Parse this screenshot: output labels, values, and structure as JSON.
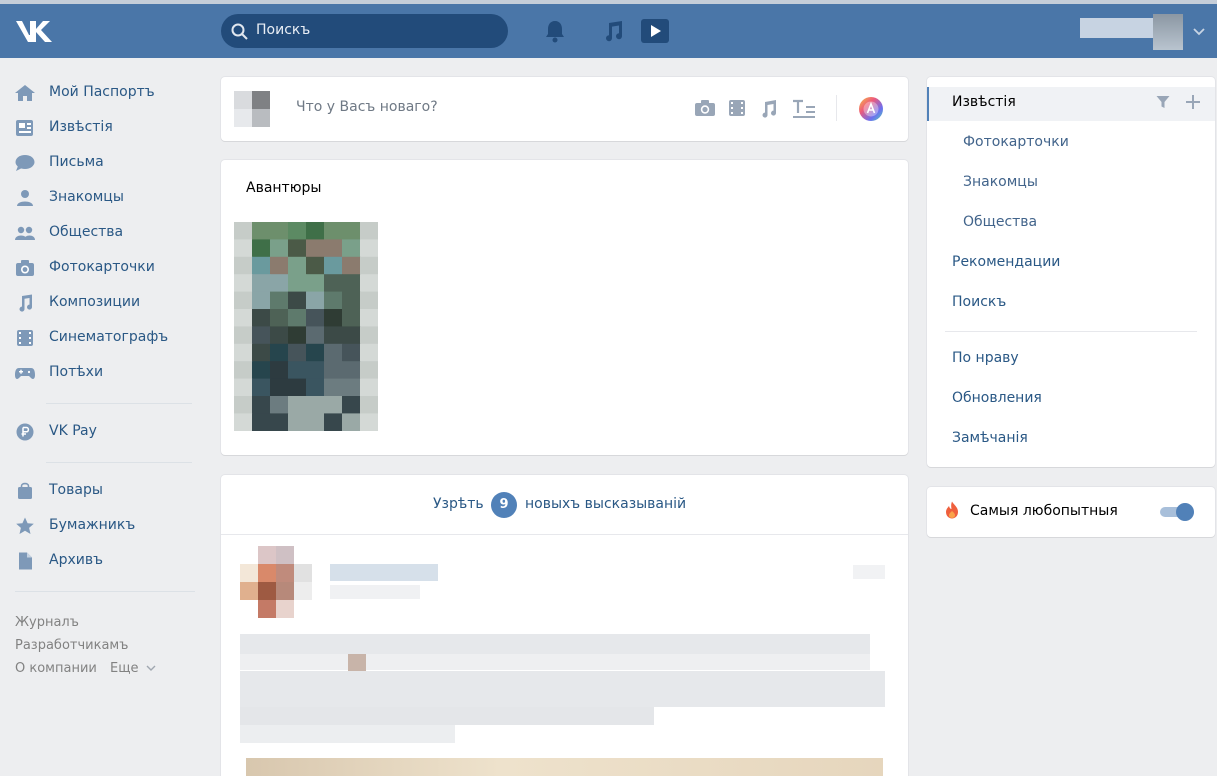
{
  "header": {
    "logo_text": "VK",
    "search_placeholder": "Поискъ"
  },
  "nav": {
    "items": [
      {
        "label": "Мой Паспортъ",
        "icon": "home-icon"
      },
      {
        "label": "Извѣстія",
        "icon": "news-icon"
      },
      {
        "label": "Письма",
        "icon": "messages-icon"
      },
      {
        "label": "Знакомцы",
        "icon": "friend-icon"
      },
      {
        "label": "Общества",
        "icon": "groups-icon"
      },
      {
        "label": "Фотокарточки",
        "icon": "camera-icon"
      },
      {
        "label": "Композиции",
        "icon": "music-icon"
      },
      {
        "label": "Синематографъ",
        "icon": "film-icon"
      },
      {
        "label": "Потѣхи",
        "icon": "gamepad-icon"
      }
    ],
    "pay": {
      "label": "VK Pay",
      "icon": "vkpay-icon"
    },
    "extra": [
      {
        "label": "Товары",
        "icon": "bag-icon"
      },
      {
        "label": "Бумажникъ",
        "icon": "star-icon"
      },
      {
        "label": "Архивъ",
        "icon": "document-icon"
      }
    ],
    "footer": {
      "journal": "Журналъ",
      "developers": "Разработчикамъ",
      "about": "О компании",
      "more": "Еще"
    }
  },
  "composer": {
    "placeholder": "Что у Васъ новаго?"
  },
  "stories": {
    "title": "Авантюры"
  },
  "feed": {
    "new_posts_prefix": "Узрѣть",
    "new_posts_count": "9",
    "new_posts_suffix": "новыхъ высказываній"
  },
  "right_menu": {
    "active": "Извѣстія",
    "subitems": [
      "Фотокарточки",
      "Знакомцы",
      "Общества"
    ],
    "items": [
      "Рекомендации",
      "Поискъ"
    ],
    "items2": [
      "По нраву",
      "Обновления",
      "Замѣчанія"
    ]
  },
  "interesting": {
    "label": "Самыя любопытныя",
    "enabled": true
  },
  "colors": {
    "header": "#4a76a8",
    "accent": "#5181b8",
    "link": "#2a5885",
    "background": "#edeef0"
  }
}
